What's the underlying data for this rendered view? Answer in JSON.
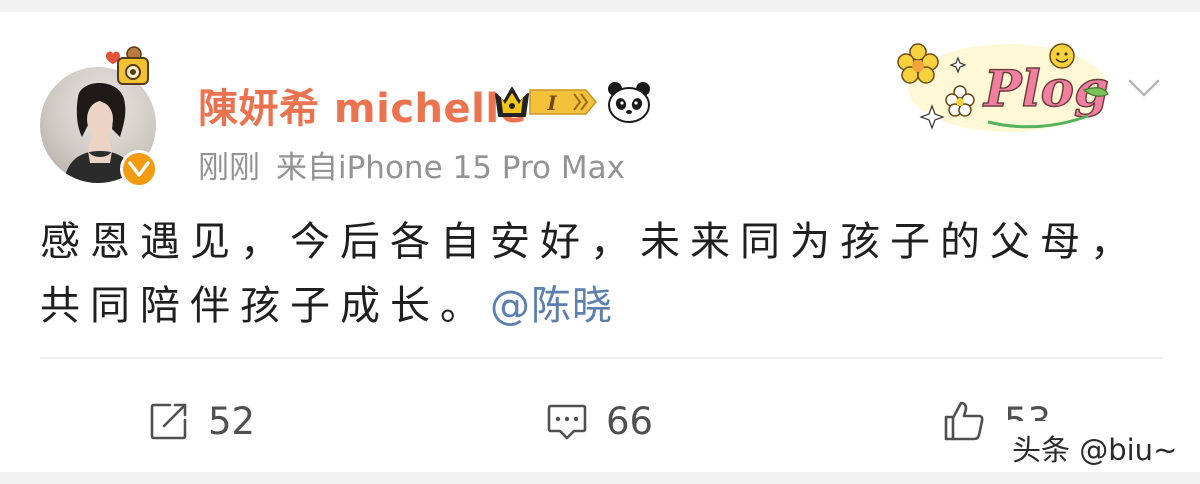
{
  "post": {
    "username": "陳妍希 michelle",
    "vip_level": "I",
    "time": "刚刚",
    "source": "来自iPhone 15 Pro Max",
    "sticker_text": "Plog",
    "text_main": "感恩遇见，今后各自安好，未来同为孩子的父母，共同陪伴孩子成长。",
    "mention": "@陈晓"
  },
  "actions": {
    "repost_count": "52",
    "comment_count": "66",
    "like_count": "53"
  },
  "watermark": "头条 @biu~",
  "colors": {
    "username": "#eb7350",
    "mention": "#5b7fae",
    "verified": "#f39c12",
    "meta": "#939393"
  },
  "icons": [
    "crown-icon",
    "panda-emoji-icon",
    "verified-icon",
    "chevron-down-icon",
    "repost-icon",
    "comment-icon",
    "like-icon"
  ]
}
